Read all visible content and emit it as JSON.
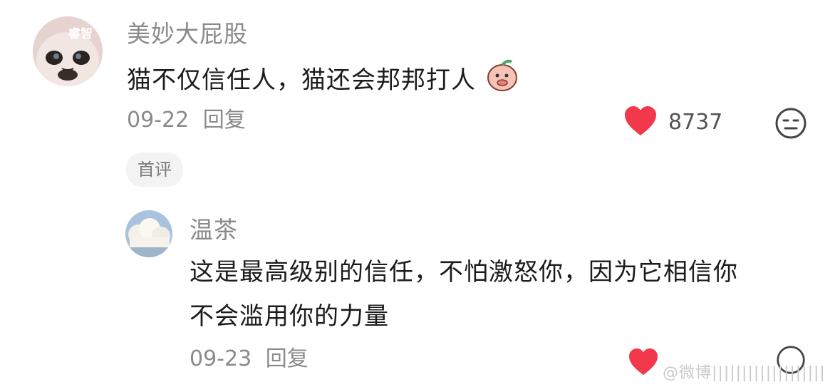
{
  "comment": {
    "avatar_text": "睿智",
    "username": "美妙大屁股",
    "text": "猫不仅信任人，猫还会邦邦打人",
    "date": "09-22",
    "reply_label": "回复",
    "like_count": "8737",
    "badge": "首评"
  },
  "reply": {
    "username": "温茶",
    "text_line1": "这是最高级别的信任，不怕激怒你，因为它相信你",
    "text_line2": "不会滥用你的力量",
    "date": "09-23",
    "reply_label": "回复"
  },
  "watermark": "@微博|||||||||||||||||||",
  "colors": {
    "like": "#f2384b",
    "meta": "#8a8a8a",
    "text": "#1c1c1c"
  },
  "icons": [
    "cat-avatar",
    "cloud-avatar",
    "peach-emoji-icon",
    "heart-icon",
    "dislike-face-icon"
  ]
}
